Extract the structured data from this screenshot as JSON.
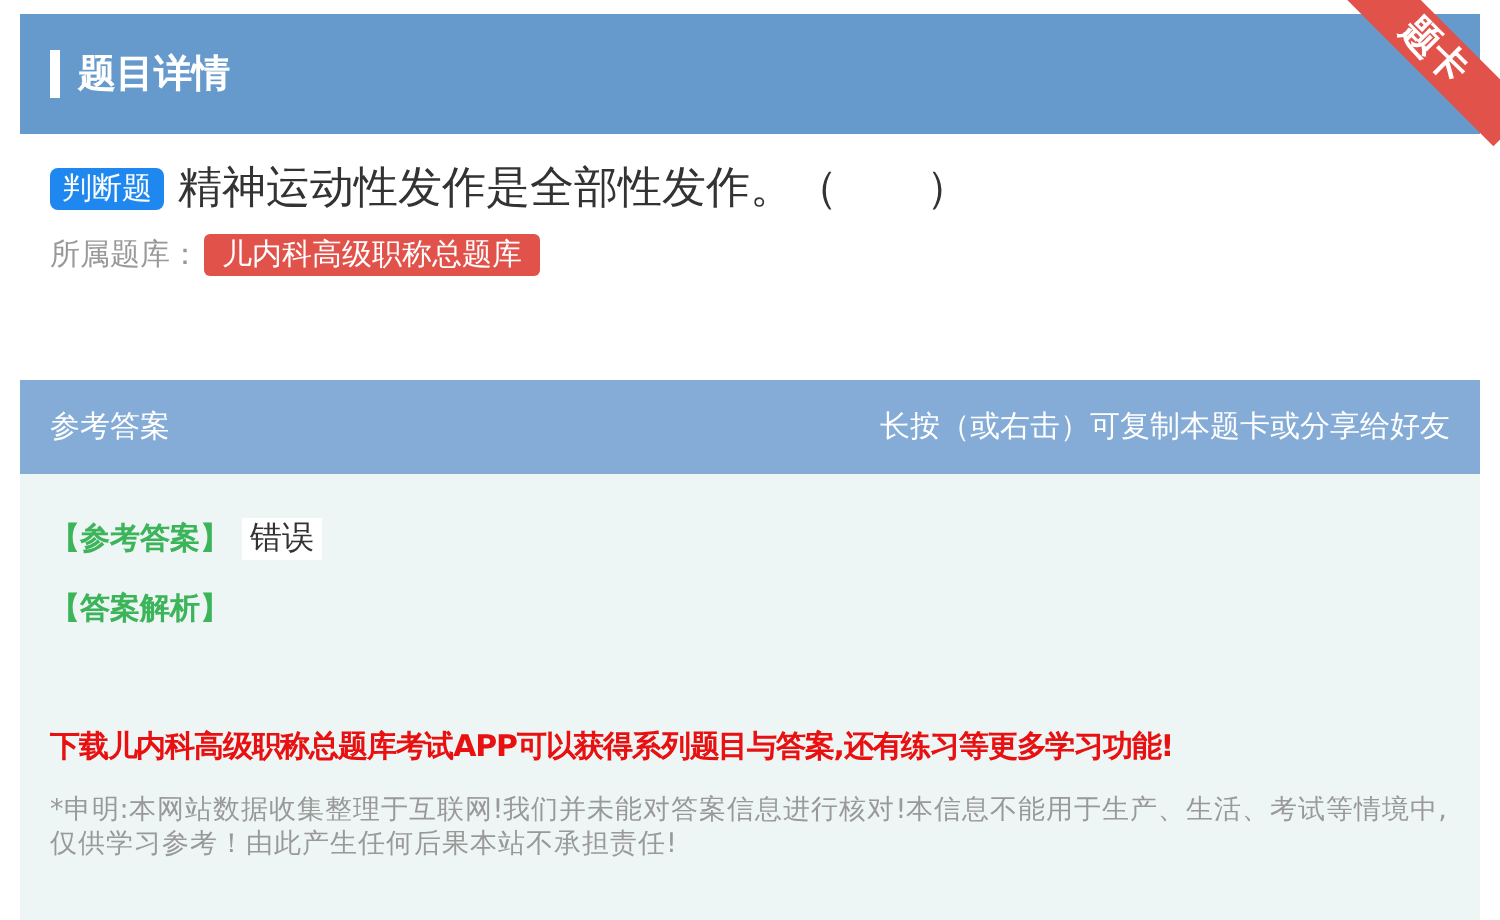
{
  "header": {
    "title": "题目详情",
    "ribbon": "题卡"
  },
  "question": {
    "type_badge": "判断题",
    "text": "精神运动性发作是全部性发作。（　　）"
  },
  "source": {
    "label": "所属题库：",
    "bank": "儿内科高级职称总题库"
  },
  "answer_panel": {
    "title": "参考答案",
    "hint": "长按（或右击）可复制本题卡或分享给好友",
    "answer_label": "【参考答案】",
    "answer": "错误",
    "analysis_label": "【答案解析】",
    "promo": "下载儿内科高级职称总题库考试APP可以获得系列题目与答案,还有练习等更多学习功能!",
    "disclaimer": "*申明:本网站数据收集整理于互联网!我们并未能对答案信息进行核对!本信息不能用于生产、生活、考试等情境中,仅供学习参考！由此产生任何后果本站不承担责任!"
  }
}
